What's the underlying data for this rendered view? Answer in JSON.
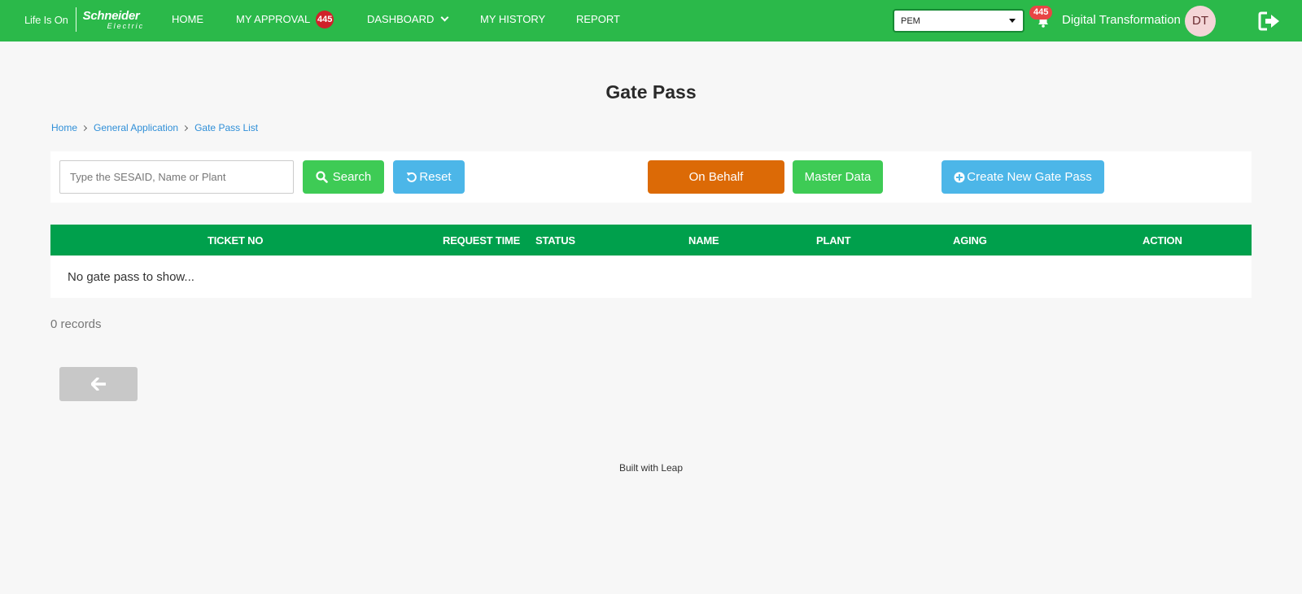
{
  "header": {
    "brand": {
      "tagline": "Life Is On",
      "company": "Schneider",
      "division": "Electric"
    },
    "nav": [
      {
        "label": "HOME",
        "icon": ""
      },
      {
        "label": "MY APPROVAL",
        "badge": "445"
      },
      {
        "label": "DASHBOARD",
        "icon": "chevron-down-icon"
      },
      {
        "label": "MY HISTORY"
      },
      {
        "label": "REPORT"
      }
    ],
    "plant_select": {
      "value": "PEM"
    },
    "notifications": {
      "icon": "bell-icon",
      "count": "445"
    },
    "user": {
      "name": "Digital Transformation",
      "initials": "DT"
    },
    "logout_icon": "logout-icon"
  },
  "page": {
    "title": "Gate Pass",
    "breadcrumb": [
      "Home",
      "General Application",
      "Gate Pass List"
    ]
  },
  "toolbar": {
    "search_placeholder": "Type the SESAID, Name or Plant",
    "search_value": "",
    "search_label": "Search",
    "reset_label": "Reset",
    "on_behalf_label": "On Behalf",
    "master_data_label": "Master Data",
    "create_label": "Create New Gate Pass"
  },
  "table": {
    "columns": [
      "TICKET NO",
      "REQUEST TIME",
      "STATUS",
      "NAME",
      "PLANT",
      "AGING",
      "ACTION"
    ],
    "rows": [],
    "empty_message": "No gate pass to show..."
  },
  "records_text": "0 records",
  "back_icon": "arrow-left-icon",
  "footer": "Built with Leap",
  "colors": {
    "header_bg": "#2bb94a",
    "table_header_bg": "#00a04c",
    "search_btn": "#3ecb55",
    "reset_btn": "#4cb6e8",
    "on_behalf_btn": "#dc6a06",
    "badge": "#d0212a",
    "link": "#2f8fd8"
  }
}
